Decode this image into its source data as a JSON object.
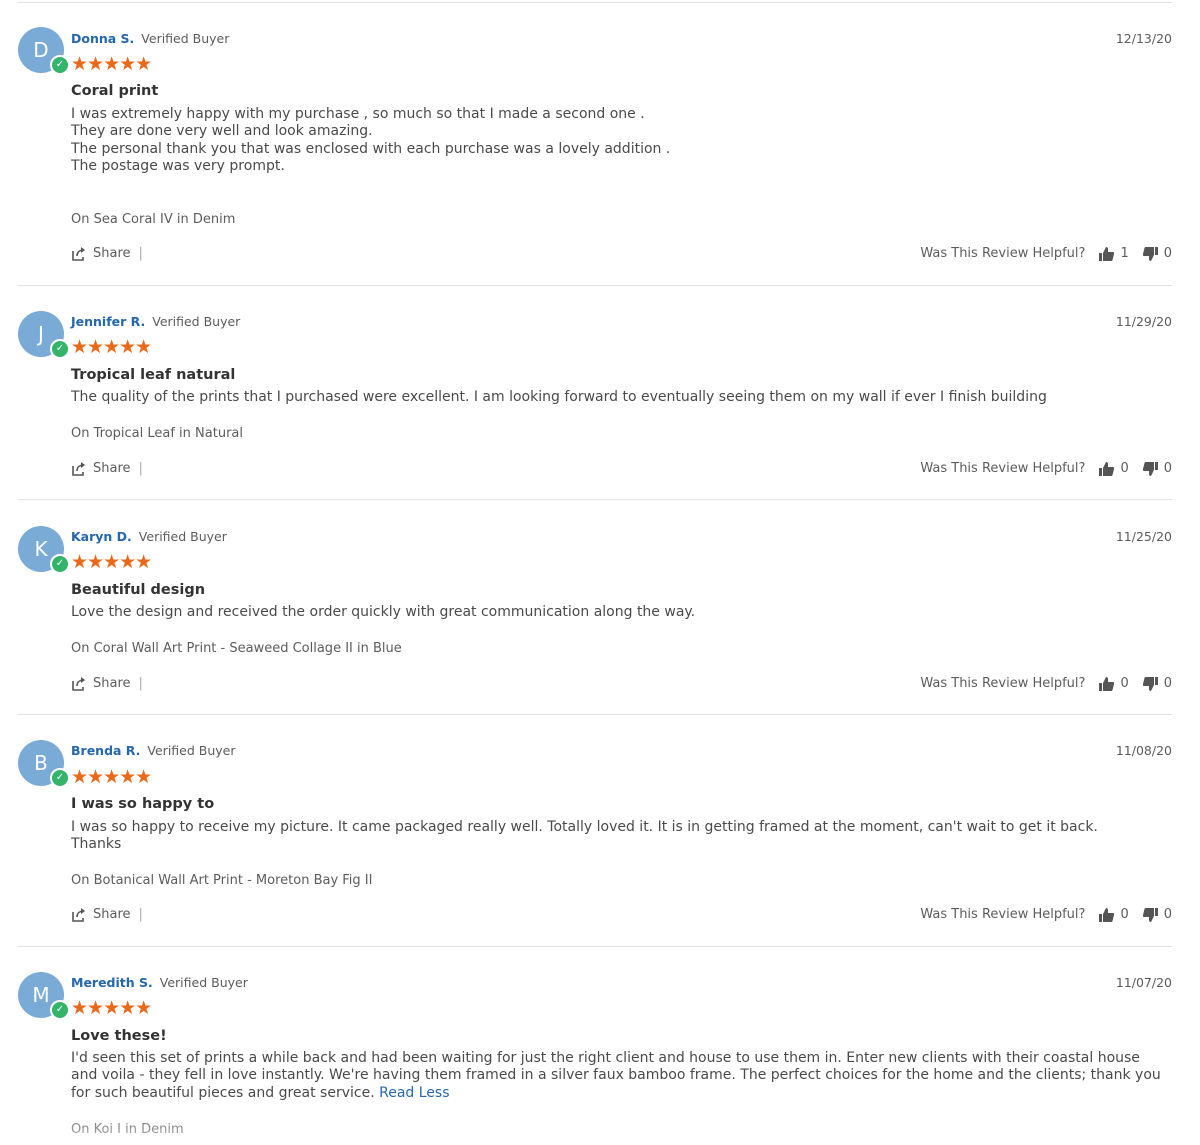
{
  "ui": {
    "verified_label": "Verified Buyer",
    "share_label": "Share",
    "helpful_label": "Was This Review Helpful?",
    "read_less": "Read Less",
    "star_color": "#ea6a1c",
    "name_color": "#2467ad",
    "verified_badge_color": "#34b36b"
  },
  "reviews": [
    {
      "initial": "D",
      "name": "Donna S.",
      "date": "12/13/20",
      "rating": 5,
      "stars": "★★★★★",
      "title": "Coral print",
      "body": [
        "I was extremely happy with my purchase , so much so that I made a second one .",
        "They are done very well and look amazing.",
        "The personal thank you that was enclosed with each purchase was a lovely addition .",
        "The postage was very prompt."
      ],
      "product": "On Sea Coral IV in Denim",
      "up": "1",
      "down": "0"
    },
    {
      "initial": "J",
      "name": "Jennifer R.",
      "date": "11/29/20",
      "rating": 5,
      "stars": "★★★★★",
      "title": "Tropical leaf natural",
      "body": [
        "The quality of the prints that I purchased were excellent. I am looking forward to eventually seeing them on my wall if ever I finish building"
      ],
      "product": "On Tropical Leaf in Natural",
      "up": "0",
      "down": "0"
    },
    {
      "initial": "K",
      "name": "Karyn D.",
      "date": "11/25/20",
      "rating": 5,
      "stars": "★★★★★",
      "title": "Beautiful design",
      "body": [
        "Love the design and received the order quickly with great communication along the way."
      ],
      "product": "On Coral Wall Art Print - Seaweed Collage II in Blue",
      "up": "0",
      "down": "0"
    },
    {
      "initial": "B",
      "name": "Brenda R.",
      "date": "11/08/20",
      "rating": 5,
      "stars": "★★★★★",
      "title": "I was so happy to",
      "body": [
        "I was so happy to receive my picture. It came packaged really well. Totally loved it. It is in getting framed at the moment, can't wait to get it back.",
        "Thanks"
      ],
      "product": "On Botanical Wall Art Print - Moreton Bay Fig II",
      "up": "0",
      "down": "0"
    },
    {
      "initial": "M",
      "name": "Meredith S.",
      "date": "11/07/20",
      "rating": 5,
      "stars": "★★★★★",
      "title": "Love these!",
      "body_text": "I'd seen this set of prints a while back and had been waiting for just the right client and house to use them in. Enter new clients with their coastal house and voila - they fell in love instantly. We're having them framed in a silver faux bamboo frame. The perfect choices for the home and the clients; thank you for such beautiful pieces and great service.",
      "product": "On Koi I in Denim"
    }
  ]
}
